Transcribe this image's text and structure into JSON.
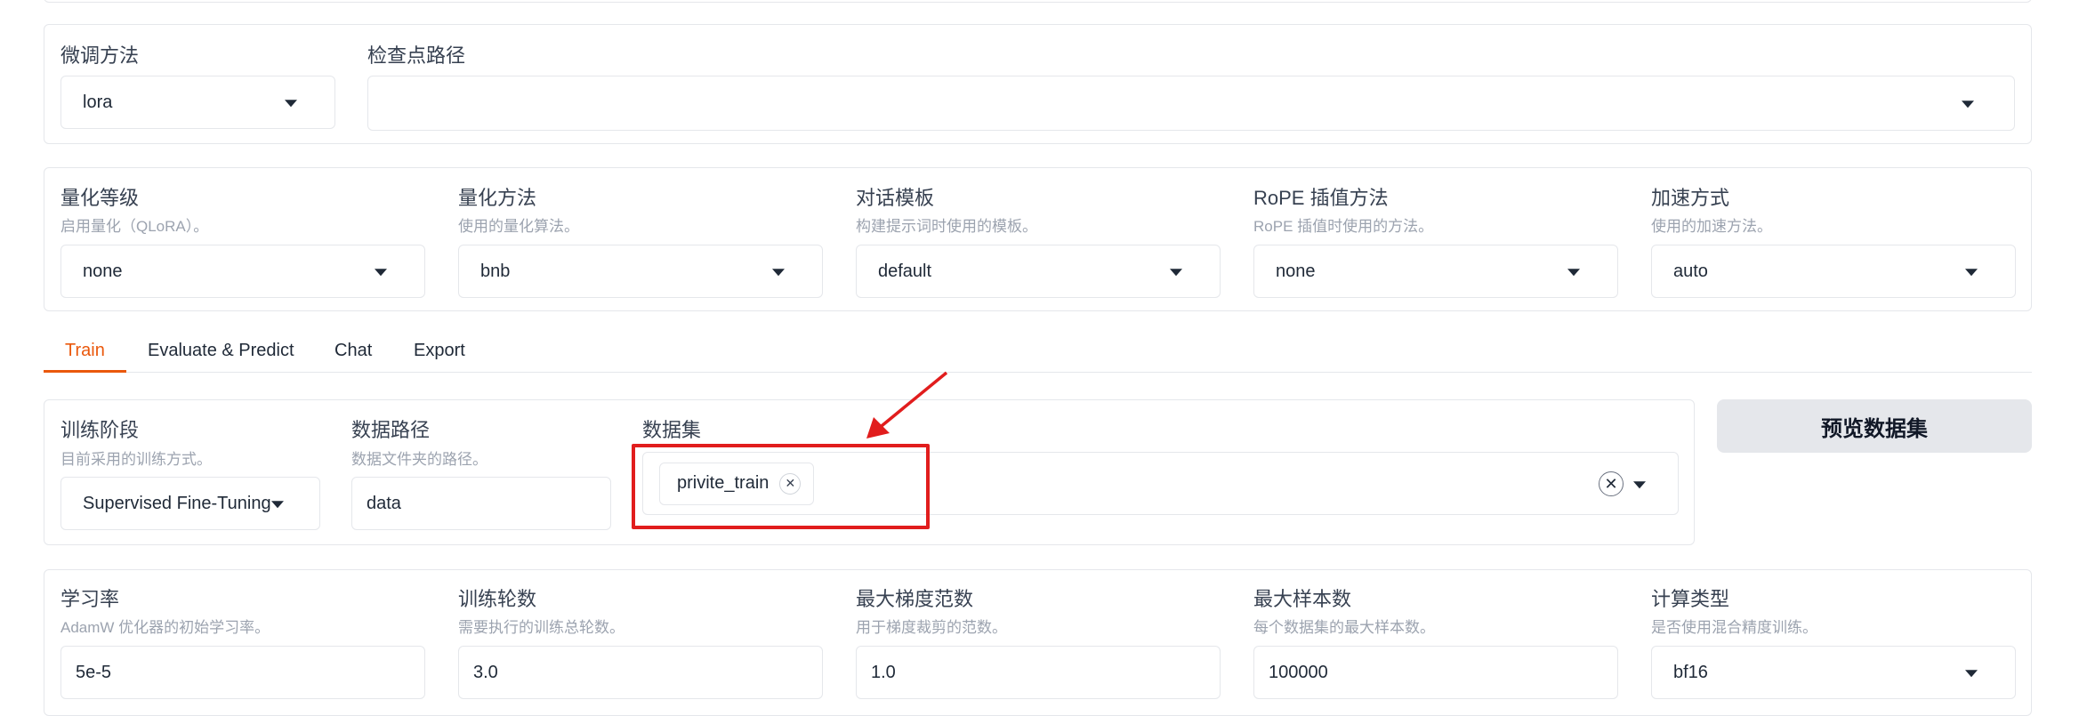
{
  "finetune": {
    "method_label": "微调方法",
    "method_value": "lora",
    "checkpoint_label": "检查点路径",
    "checkpoint_value": ""
  },
  "config": {
    "quant_bit_label": "量化等级",
    "quant_bit_hint": "启用量化（QLoRA）。",
    "quant_bit_value": "none",
    "quant_method_label": "量化方法",
    "quant_method_hint": "使用的量化算法。",
    "quant_method_value": "bnb",
    "template_label": "对话模板",
    "template_hint": "构建提示词时使用的模板。",
    "template_value": "default",
    "rope_label": "RoPE 插值方法",
    "rope_hint": "RoPE 插值时使用的方法。",
    "rope_value": "none",
    "booster_label": "加速方式",
    "booster_hint": "使用的加速方法。",
    "booster_value": "auto"
  },
  "tabs": [
    "Train",
    "Evaluate & Predict",
    "Chat",
    "Export"
  ],
  "active_tab": "Train",
  "train": {
    "stage_label": "训练阶段",
    "stage_hint": "目前采用的训练方式。",
    "stage_value": "Supervised Fine-Tuning",
    "dataset_dir_label": "数据路径",
    "dataset_dir_hint": "数据文件夹的路径。",
    "dataset_dir_value": "data",
    "dataset_label": "数据集",
    "dataset_selected": [
      "privite_train"
    ],
    "preview_button": "预览数据集"
  },
  "hyper": {
    "lr_label": "学习率",
    "lr_hint": "AdamW 优化器的初始学习率。",
    "lr_value": "5e-5",
    "epochs_label": "训练轮数",
    "epochs_hint": "需要执行的训练总轮数。",
    "epochs_value": "3.0",
    "grad_label": "最大梯度范数",
    "grad_hint": "用于梯度裁剪的范数。",
    "grad_value": "1.0",
    "samples_label": "最大样本数",
    "samples_hint": "每个数据集的最大样本数。",
    "samples_value": "100000",
    "compute_label": "计算类型",
    "compute_hint": "是否使用混合精度训练。",
    "compute_value": "bf16"
  },
  "colors": {
    "accent": "#ea580c",
    "annotation": "#e11d1d",
    "border": "#e5e7eb",
    "button_bg": "#e5e7eb"
  }
}
